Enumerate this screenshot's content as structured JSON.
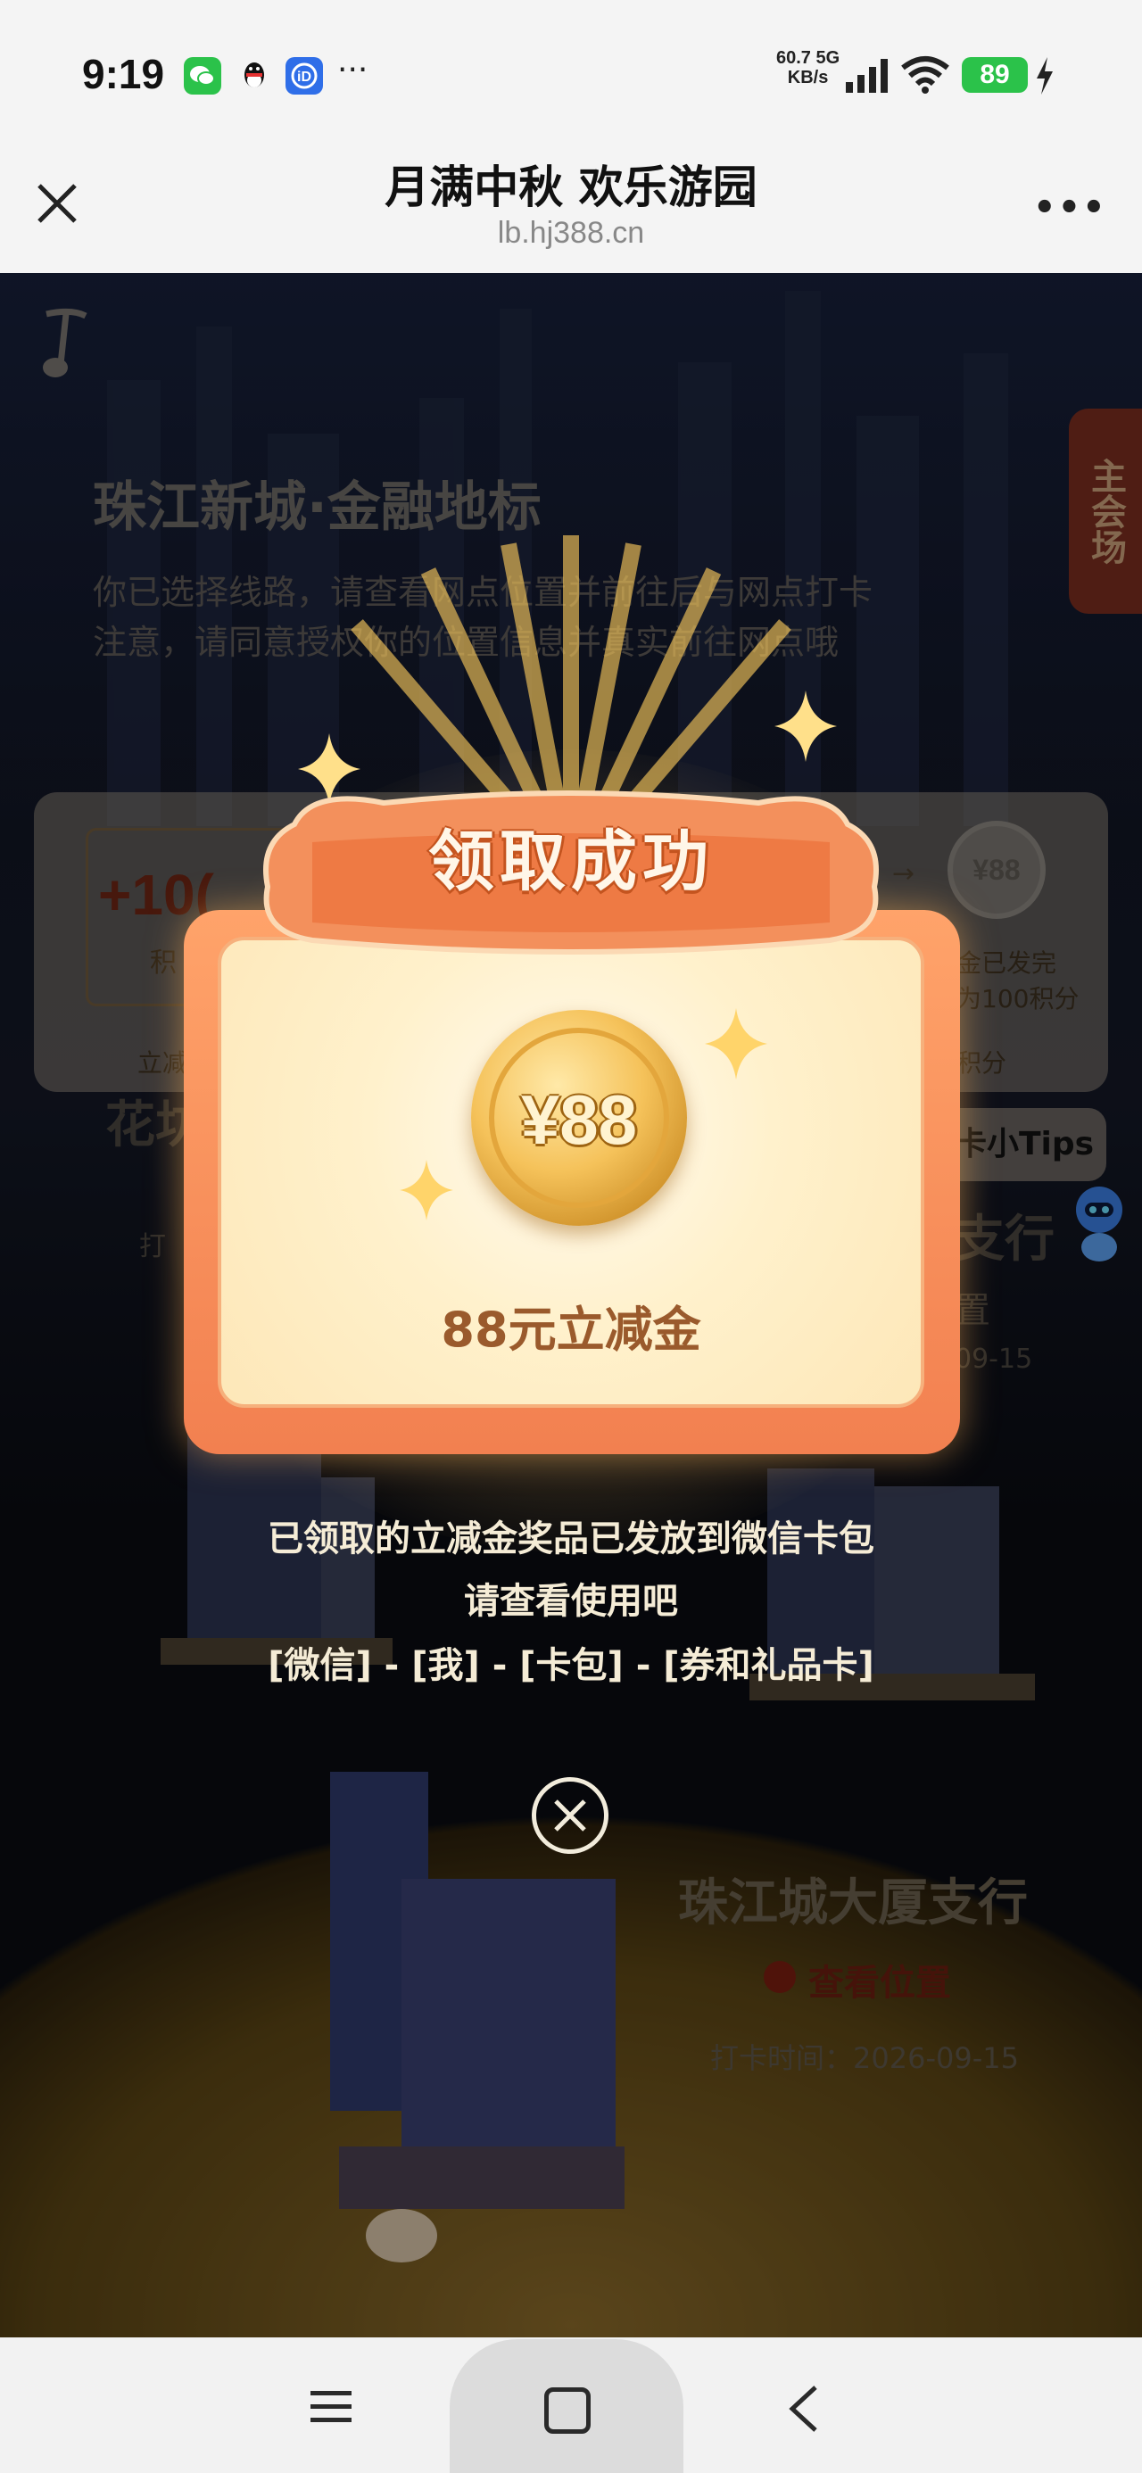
{
  "status_bar": {
    "time": "9:19",
    "apps": [
      "wechat-icon",
      "qq-icon",
      "app-icon"
    ],
    "more": "···",
    "net_speed": "60.7",
    "net_unit": "KB/s",
    "net_type": "5G",
    "battery": "89"
  },
  "navbar": {
    "title": "月满中秋 欢乐游园",
    "url": "lb.hj388.cn",
    "more": "•••"
  },
  "background": {
    "main_venue": "主会场",
    "route_title": "珠江新城·金融地标",
    "route_desc_1": "你已选择线路，请查看网点位置并前往后与网点打卡",
    "route_desc_2": "注意，请同意授权你的位置信息并真实前往网点哦",
    "points_value": "+10(",
    "points_unit": "积",
    "card_foot_left": "立减",
    "coin_small": "¥88",
    "card_right_1": "金已发完",
    "card_right_2": "为100积分",
    "card_foot_right": "积分",
    "tips": "卡小Tips",
    "left_title": "花坊",
    "left_sub": "打",
    "right_title": "支行",
    "right_sub": "置",
    "right_date": "09-15",
    "branch": "珠江城大厦支行",
    "location": "查看位置",
    "check_time": "打卡时间：2026-09-15"
  },
  "popup": {
    "title": "领取成功",
    "coin_label": "¥88",
    "prize_name": "88元立减金",
    "message_1": "已领取的立减金奖品已发放到微信卡包",
    "message_2": "请查看使用吧",
    "message_3": "[微信] - [我] - [卡包] - [券和礼品卡]"
  },
  "colors": {
    "accent_orange": "#f28050",
    "coin_gold": "#f5c25a",
    "prize_text": "#9a5a2c",
    "battery_green": "#2bc24a"
  }
}
